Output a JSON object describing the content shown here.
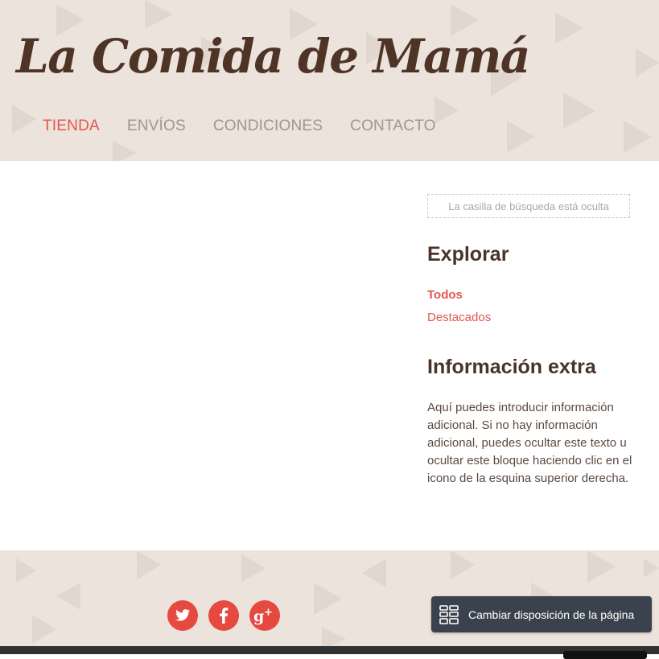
{
  "site": {
    "title": "La Comida de Mamá"
  },
  "nav": {
    "items": [
      "TIENDA",
      "ENVÍOS",
      "CONDICIONES",
      "CONTACTO"
    ]
  },
  "sidebar": {
    "search_placeholder": "La casilla de búsqueda está oculta",
    "explore_heading": "Explorar",
    "links": [
      "Todos",
      "Destacados"
    ],
    "info_heading": "Información extra",
    "info_text": "Aquí puedes introducir información adicional. Si no hay información adicional, puedes ocultar este texto u ocultar este bloque haciendo clic en el icono de la esquina superior derecha."
  },
  "footer": {
    "social_icons": [
      "twitter-icon",
      "facebook-icon",
      "google-plus-icon"
    ],
    "layout_button_label": "Cambiar disposición de la página",
    "layout_button_icon": "layout-grid-icon"
  },
  "colors": {
    "accent": "#e3574c",
    "logo": "#4e3426",
    "pattern_bg": "#ece3dc",
    "nav_inactive": "#a59489",
    "social_bg": "#e6493f",
    "layout_button_bg": "#3a434d"
  }
}
